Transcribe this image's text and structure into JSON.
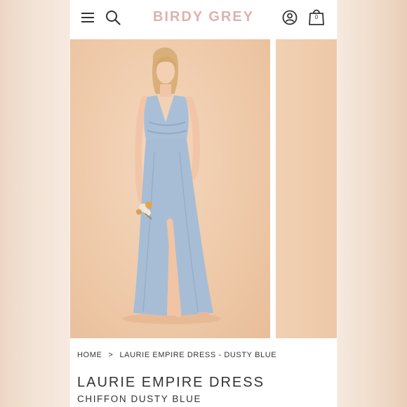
{
  "header": {
    "brand": "BIRDY GREY",
    "brand_color": "#ddb3ad",
    "cart_count": "0",
    "icons": [
      "hamburger-menu-icon",
      "search-icon",
      "account-icon",
      "shopping-bag-icon"
    ]
  },
  "gallery": {
    "main_image": "model wearing long dusty blue chiffon V-neck dress holding small flower bouquet",
    "background_color": "#efcaa9",
    "dress_color": "#a9bfd7"
  },
  "breadcrumb": {
    "home": "HOME",
    "separator": ">",
    "current": "LAURIE EMPIRE DRESS - DUSTY BLUE"
  },
  "product": {
    "title": "LAURIE EMPIRE DRESS",
    "subtitle": "CHIFFON DUSTY BLUE"
  }
}
